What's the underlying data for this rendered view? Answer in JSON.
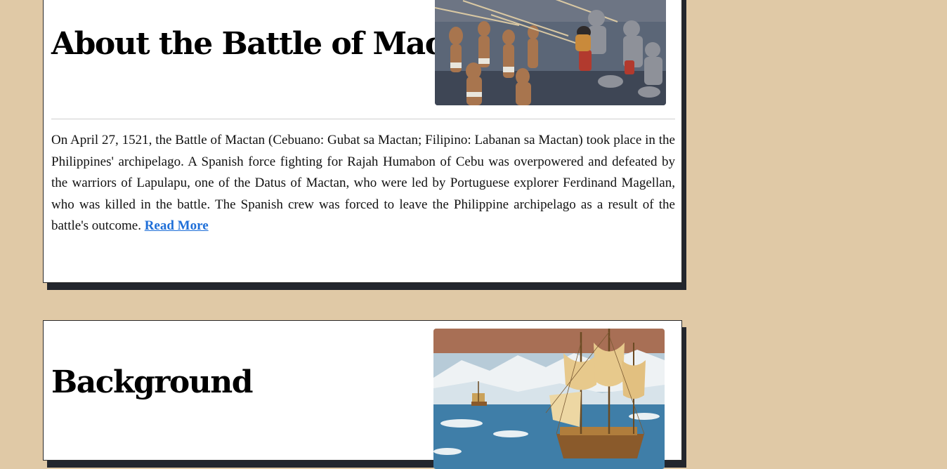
{
  "sections": {
    "about": {
      "title": "About the Battle of Mactan",
      "image_alt": "painting-battle-of-mactan",
      "body": "On April 27, 1521, the Battle of Mactan (Cebuano: Gubat sa Mactan; Filipino: Labanan sa Mactan) took place in the Philippines' archipelago. A Spanish force fighting for Rajah Humabon of Cebu was overpowered and defeated by the warriors of Lapulapu, one of the Datus of Mactan, who were led by Portuguese explorer Ferdinand Magellan, who was killed in the battle. The Spanish crew was forced to leave the Philippine archipelago as a result of the battle's outcome. ",
      "read_more": "Read More"
    },
    "background": {
      "title": "Background",
      "image_alt": "painting-galleon-at-sea"
    }
  },
  "colors": {
    "page_background": "#e0c9a6",
    "card_shadow": "#23262d",
    "link": "#1f6fd8"
  }
}
